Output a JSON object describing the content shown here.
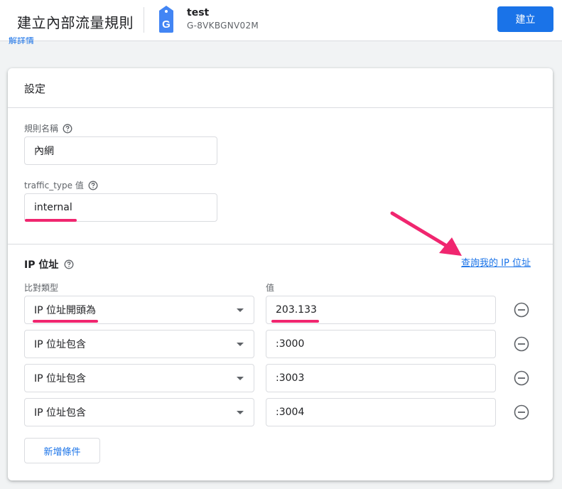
{
  "header": {
    "title": "建立內部流量規則",
    "property_name": "test",
    "property_id": "G-8VKBGNV02M",
    "create_button": "建立",
    "tag_letter": "G"
  },
  "details_link": "解詳情",
  "settings": {
    "title": "設定",
    "rule_name_label": "規則名稱",
    "rule_name_value": "內網",
    "traffic_type_label": "traffic_type 值",
    "traffic_type_value": "internal"
  },
  "ip_section": {
    "title": "IP 位址",
    "lookup_link": "查詢我的 IP 位址",
    "match_type_header": "比對類型",
    "value_header": "值",
    "rows": [
      {
        "match_type": "IP 位址開頭為",
        "value": "203.133"
      },
      {
        "match_type": "IP 位址包含",
        "value": ":3000"
      },
      {
        "match_type": "IP 位址包含",
        "value": ":3003"
      },
      {
        "match_type": "IP 位址包含",
        "value": ":3004"
      }
    ],
    "add_condition": "新增條件"
  },
  "colors": {
    "accent": "#1a73e8",
    "annotation": "#f0266f"
  },
  "icons": {
    "tag": "google-tag-icon",
    "help": "help-circle-icon",
    "remove": "remove-circle-icon",
    "dropdown": "caret-down-icon"
  }
}
